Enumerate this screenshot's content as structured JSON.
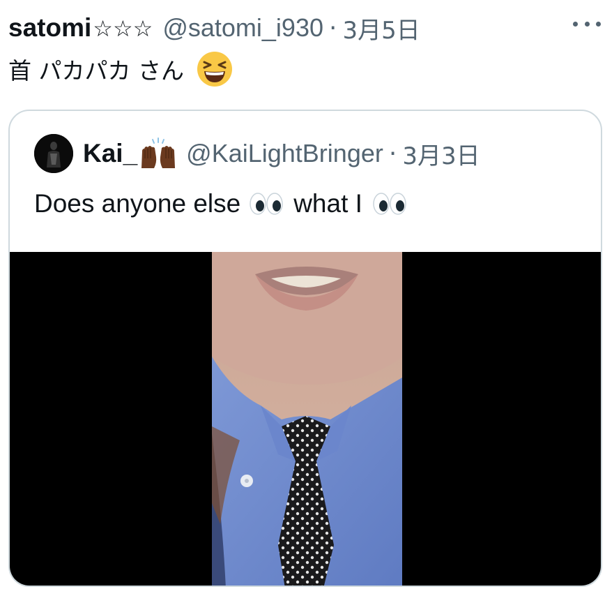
{
  "tweet": {
    "display_name": "satomi",
    "name_stars": "☆☆☆",
    "handle": "@satomi_i930",
    "separator": "·",
    "date": "3月5日",
    "text": "首 パカパカ さん",
    "emoji": "grinning-squinting-face-emoji"
  },
  "quoted_tweet": {
    "display_name": "Kai_",
    "name_emoji": "raising-hands-emoji",
    "handle": "@KaiLightBringer",
    "separator": "·",
    "date": "3月3日",
    "text_part1": "Does anyone else",
    "text_part2": "what I",
    "inline_emoji": "eyes-emoji",
    "media_type": "video",
    "media_background": "#000000"
  },
  "colors": {
    "text_primary": "#0f1419",
    "text_secondary": "#536471",
    "quote_border": "#cfd9de"
  }
}
